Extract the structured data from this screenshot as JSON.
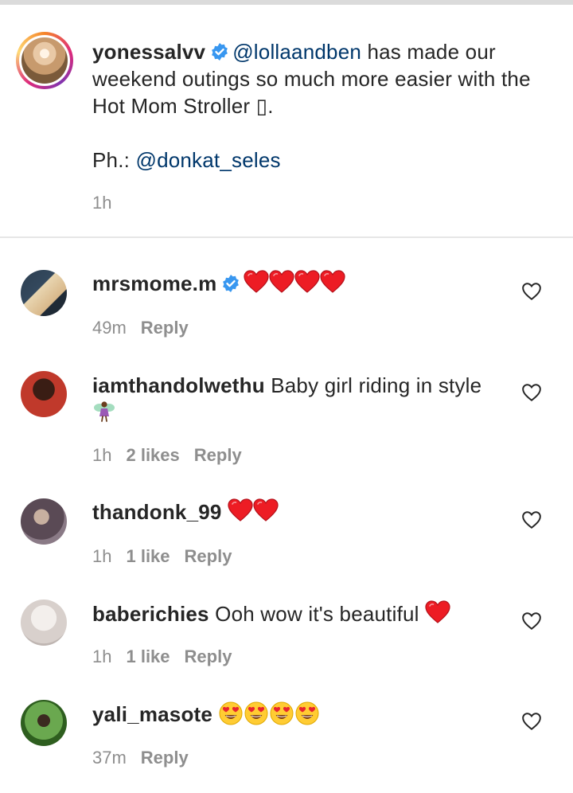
{
  "caption": {
    "username": "yonessalvv",
    "mention": "@lollaandben",
    "line1": " has made our",
    "line2": "weekend outings so much more easier with the",
    "line3": "Hot Mom Stroller ",
    "line3_glyph": "▯",
    "line3_end": ".",
    "ph_label": "Ph.: ",
    "ph_mention": "@donkat_seles",
    "time": "1h"
  },
  "comments": [
    {
      "username": "mrsmome.m",
      "verified": true,
      "text": "",
      "emoji": "red-heart x4",
      "time": "49m",
      "likes": "",
      "reply": "Reply"
    },
    {
      "username": "iamthandolwethu",
      "verified": false,
      "text": " Baby girl riding in style",
      "emoji": "fairy",
      "time": "1h",
      "likes": "2 likes",
      "reply": "Reply"
    },
    {
      "username": "thandonk_99",
      "verified": false,
      "text": "",
      "emoji": "red-heart x2",
      "time": "1h",
      "likes": "1 like",
      "reply": "Reply"
    },
    {
      "username": "baberichies",
      "verified": false,
      "text": " Ooh wow it's beautiful ",
      "emoji": "red-heart x1",
      "time": "1h",
      "likes": "1 like",
      "reply": "Reply"
    },
    {
      "username": "yali_masote",
      "verified": false,
      "text": "",
      "emoji": "heart-eyes x4",
      "time": "37m",
      "likes": "",
      "reply": "Reply"
    }
  ],
  "colors": {
    "mention": "#00376b",
    "verified": "#3897f0",
    "meta": "#8e8e8e",
    "heart": "#ed1c24"
  }
}
